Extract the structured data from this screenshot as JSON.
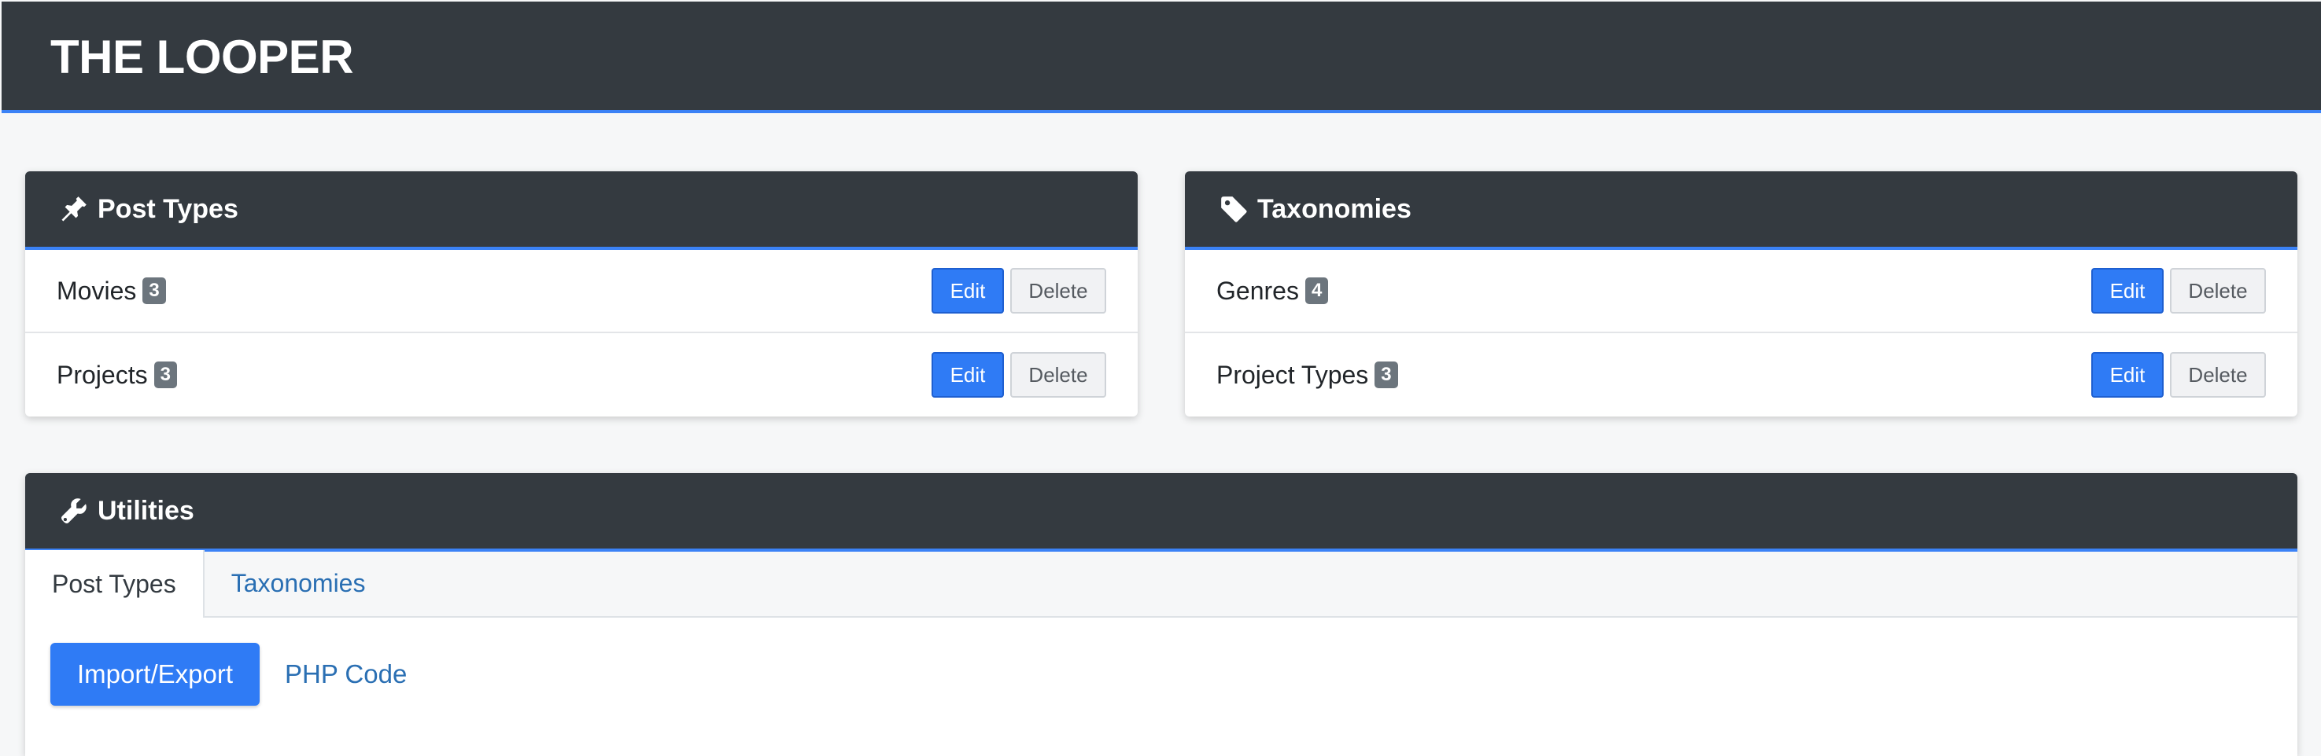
{
  "app": {
    "title": "THE LOOPER"
  },
  "post_types_panel": {
    "title": "Post Types",
    "icon": "pin-icon",
    "items": [
      {
        "name": "Movies",
        "count": "3",
        "edit_label": "Edit",
        "delete_label": "Delete"
      },
      {
        "name": "Projects",
        "count": "3",
        "edit_label": "Edit",
        "delete_label": "Delete"
      }
    ]
  },
  "taxonomies_panel": {
    "title": "Taxonomies",
    "icon": "tag-icon",
    "items": [
      {
        "name": "Genres",
        "count": "4",
        "edit_label": "Edit",
        "delete_label": "Delete"
      },
      {
        "name": "Project Types",
        "count": "3",
        "edit_label": "Edit",
        "delete_label": "Delete"
      }
    ]
  },
  "utilities_panel": {
    "title": "Utilities",
    "icon": "wrench-icon",
    "tabs": [
      {
        "label": "Post Types",
        "active": true
      },
      {
        "label": "Taxonomies",
        "active": false
      }
    ],
    "import_export_label": "Import/Export",
    "php_code_label": "PHP Code"
  },
  "colors": {
    "header_bg": "#343a40",
    "accent": "#3b82f6",
    "primary_button": "#2f7bf5",
    "link": "#2a6fb3",
    "badge": "#6c757d"
  }
}
